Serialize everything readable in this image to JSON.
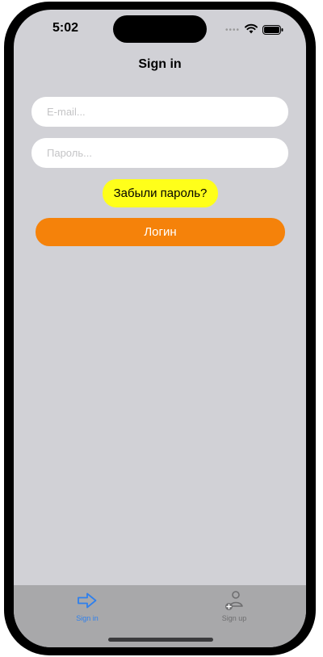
{
  "status_bar": {
    "time": "5:02"
  },
  "nav": {
    "title": "Sign in"
  },
  "form": {
    "email_placeholder": "E-mail...",
    "password_placeholder": "Пароль...",
    "email_value": "",
    "password_value": "",
    "forgot_label": "Забыли пароль?",
    "login_label": "Логин"
  },
  "tabbar": {
    "tabs": [
      {
        "label": "Sign in",
        "icon": "arrow-right-icon",
        "selected": true
      },
      {
        "label": "Sign up",
        "icon": "person-add-icon",
        "selected": false
      }
    ]
  },
  "colors": {
    "background": "#d1d1d6",
    "field_background": "#ffffff",
    "forgot_button": "#ffff1a",
    "login_button": "#f5820a",
    "tab_selected": "#2f80ed",
    "tab_unselected": "#6e6e70",
    "tabbar_background": "#a8a8aa"
  }
}
